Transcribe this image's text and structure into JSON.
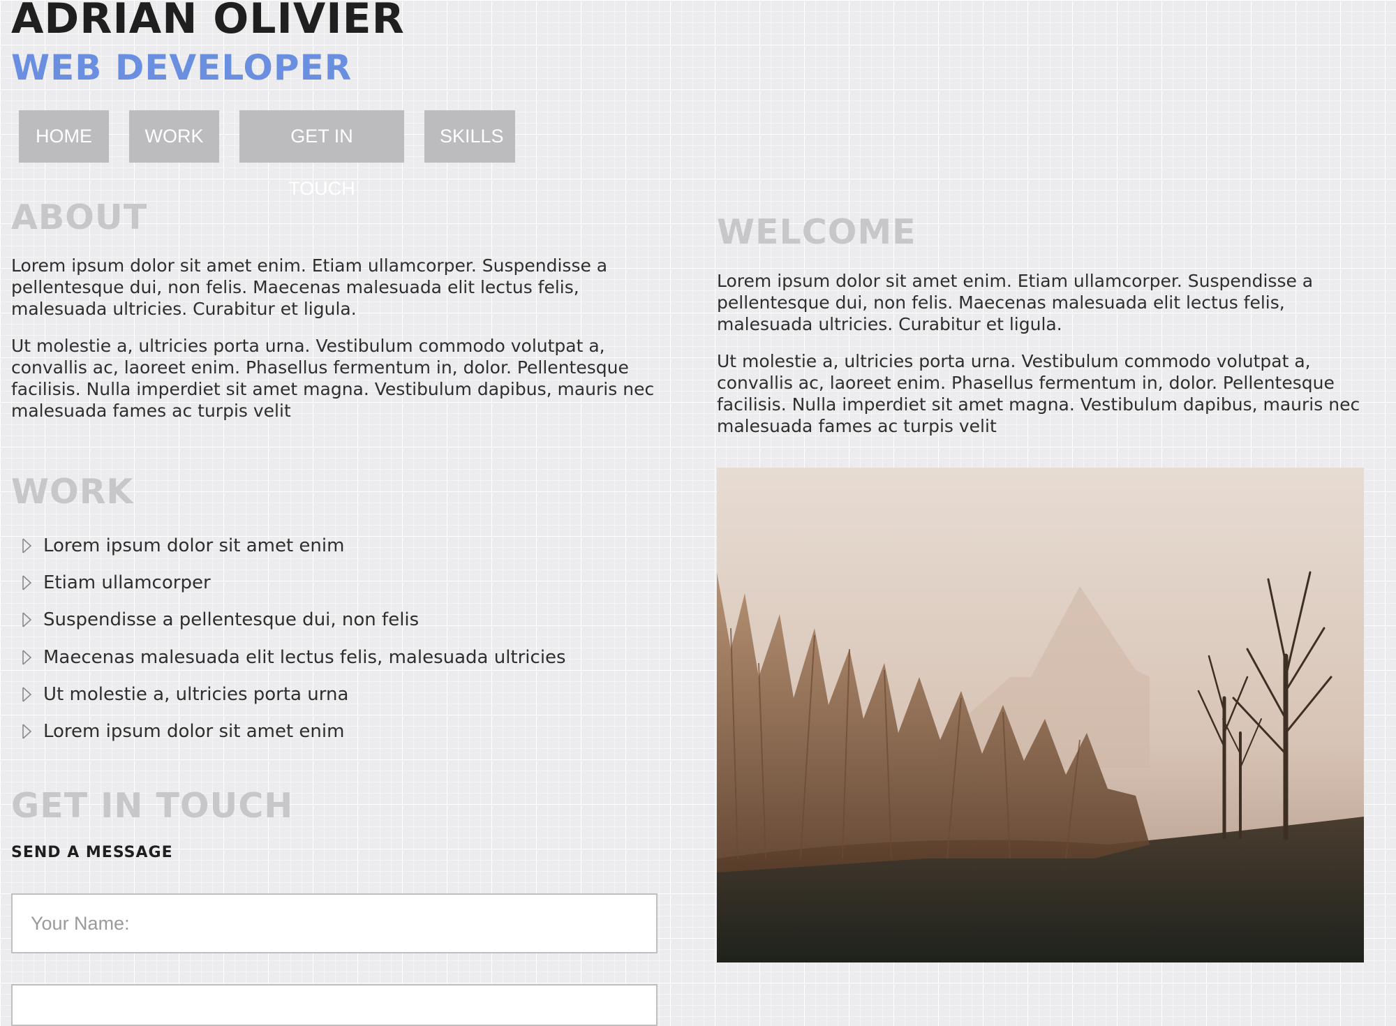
{
  "header": {
    "name": "ADRIAN OLIVIER",
    "role": "WEB DEVELOPER"
  },
  "nav": {
    "items": [
      "HOME",
      "WORK",
      "GET IN TOUCH",
      "SKILLS"
    ]
  },
  "about": {
    "title": "ABOUT",
    "paragraphs": [
      "Lorem ipsum dolor sit amet enim. Etiam ullamcorper. Suspendisse a pellentesque dui, non felis. Maecenas malesuada elit lectus felis, malesuada ultricies. Curabitur et ligula.",
      "Ut molestie a, ultricies porta urna. Vestibulum commodo volutpat a, convallis ac, laoreet enim. Phasellus fermentum in, dolor. Pellentesque facilisis. Nulla imperdiet sit amet magna. Vestibulum dapibus, mauris nec malesuada fames ac turpis velit"
    ]
  },
  "welcome": {
    "title": "WELCOME",
    "paragraphs": [
      "Lorem ipsum dolor sit amet enim. Etiam ullamcorper. Suspendisse a pellentesque dui, non felis. Maecenas malesuada elit lectus felis, malesuada ultricies. Curabitur et ligula.",
      "Ut molestie a, ultricies porta urna. Vestibulum commodo volutpat a, convallis ac, laoreet enim. Phasellus fermentum in, dolor. Pellentesque facilisis. Nulla imperdiet sit amet magna. Vestibulum dapibus, mauris nec malesuada fames ac turpis velit"
    ]
  },
  "work": {
    "title": "WORK",
    "items": [
      "Lorem ipsum dolor sit amet enim",
      "Etiam ullamcorper",
      "Suspendisse a pellentesque dui, non felis",
      "Maecenas malesuada elit lectus felis, malesuada ultricies",
      "Ut molestie a, ultricies porta urna",
      "Lorem ipsum dolor sit amet enim"
    ]
  },
  "contact": {
    "title": "GET IN TOUCH",
    "subtitle": "SEND A MESSAGE",
    "name_placeholder": "Your Name:"
  },
  "colors": {
    "background": "#ececee",
    "role_blue": "#6a8fe0",
    "nav_button": "#bcbcbe",
    "section_title": "#c7c7c9"
  },
  "icons": {
    "list_bullet": "chevron-right-icon"
  }
}
